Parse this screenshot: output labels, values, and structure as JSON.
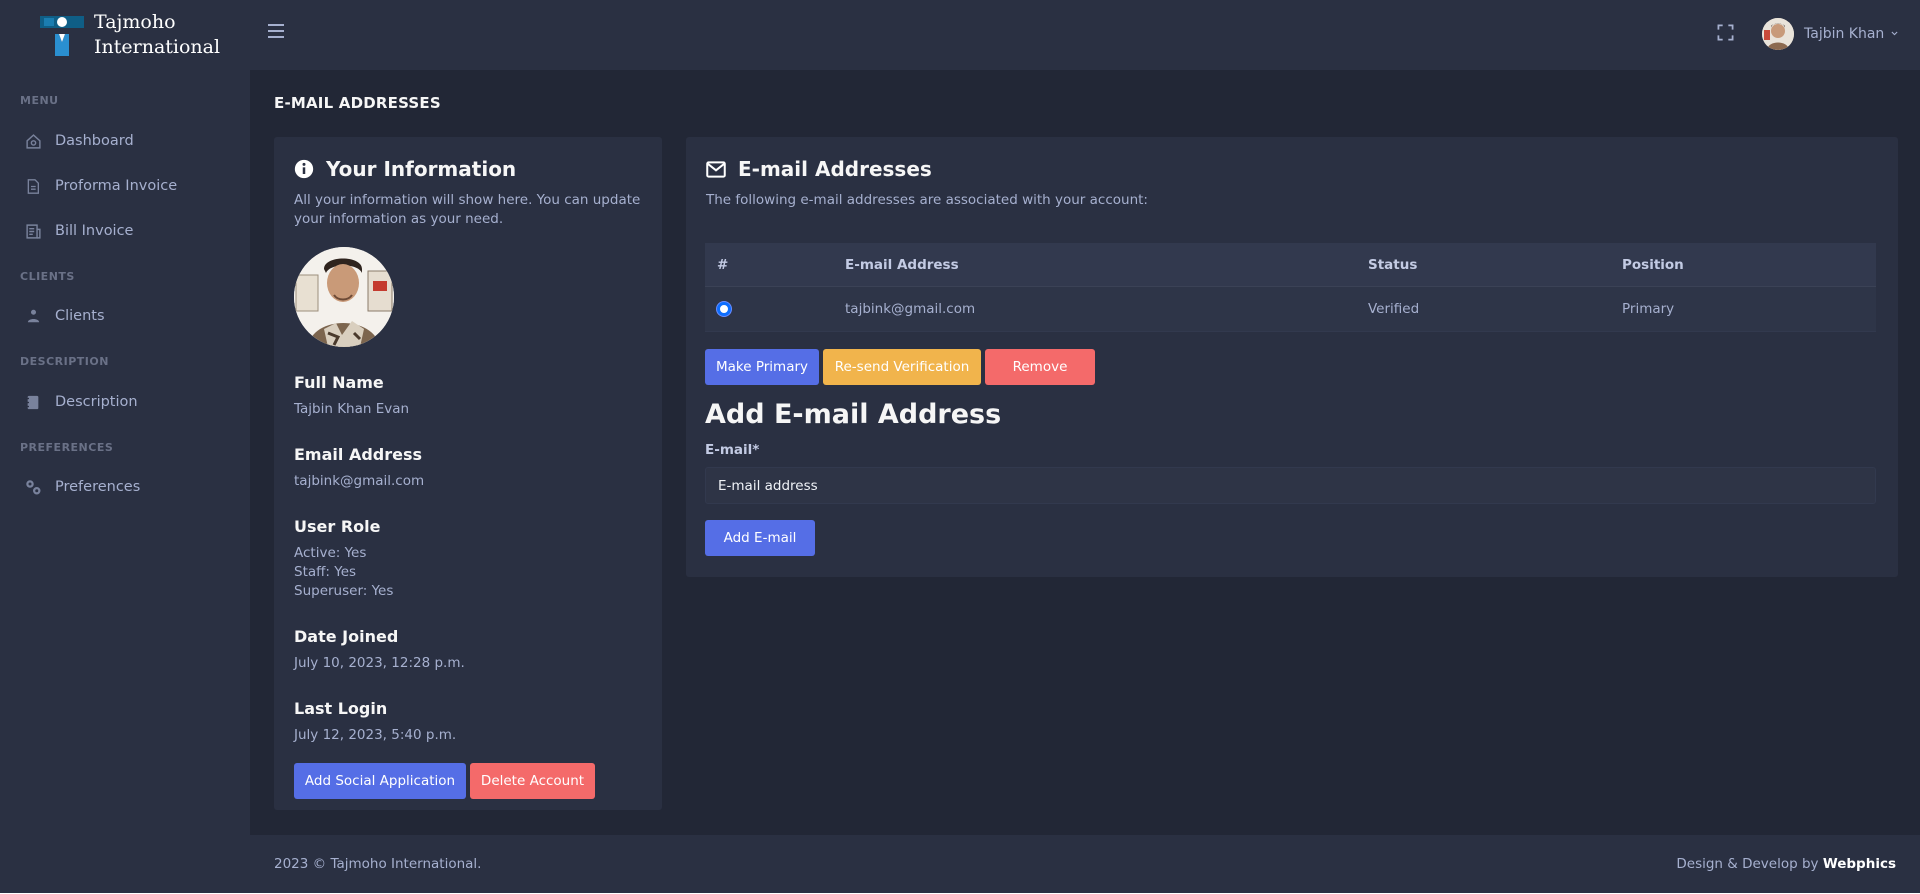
{
  "brand": {
    "line1": "Tajmoho",
    "line2": "International"
  },
  "sidebar": {
    "sections": [
      {
        "title": "MENU"
      },
      {
        "title": "CLIENTS"
      },
      {
        "title": "DESCRIPTION"
      },
      {
        "title": "PREFERENCES"
      }
    ],
    "items": [
      {
        "label": "Dashboard",
        "icon": "home-icon"
      },
      {
        "label": "Proforma Invoice",
        "icon": "document-icon"
      },
      {
        "label": "Bill Invoice",
        "icon": "receipt-icon"
      },
      {
        "label": "Clients",
        "icon": "user-icon"
      },
      {
        "label": "Description",
        "icon": "notebook-icon"
      },
      {
        "label": "Preferences",
        "icon": "gears-icon"
      }
    ]
  },
  "header": {
    "user_name": "Tajbin Khan"
  },
  "page": {
    "title": "E-MAIL ADDRESSES"
  },
  "info_card": {
    "title": "Your Information",
    "subtitle": "All your information will show here. You can update your information as your need.",
    "full_name_label": "Full Name",
    "full_name": "Tajbin Khan Evan",
    "email_label": "Email Address",
    "email": "tajbink@gmail.com",
    "role_label": "User Role",
    "active": "Active: Yes",
    "staff": "Staff: Yes",
    "superuser": "Superuser: Yes",
    "joined_label": "Date Joined",
    "joined": "July 10, 2023, 12:28 p.m.",
    "last_login_label": "Last Login",
    "last_login": "July 12, 2023, 5:40 p.m.",
    "add_social_label": "Add Social Application",
    "delete_label": "Delete Account"
  },
  "email_card": {
    "title": "E-mail Addresses",
    "subtitle": "The following e-mail addresses are associated with your account:",
    "columns": [
      "#",
      "E-mail Address",
      "Status",
      "Position"
    ],
    "rows": [
      {
        "email": "tajbink@gmail.com",
        "status": "Verified",
        "position": "Primary"
      }
    ],
    "make_primary_label": "Make Primary",
    "resend_label": "Re-send Verification",
    "remove_label": "Remove",
    "add_title": "Add E-mail Address",
    "email_field_label": "E-mail*",
    "email_placeholder": "E-mail address",
    "add_button_label": "Add E-mail"
  },
  "footer": {
    "left": "2023 © Tajmoho International.",
    "right_prefix": "Design & Develop by",
    "right_brand": "Webphics"
  },
  "colors": {
    "primary": "#556ee6",
    "danger": "#f46a6a",
    "warning": "#f1b44c",
    "background": "#222736",
    "panel": "#2a3042"
  }
}
